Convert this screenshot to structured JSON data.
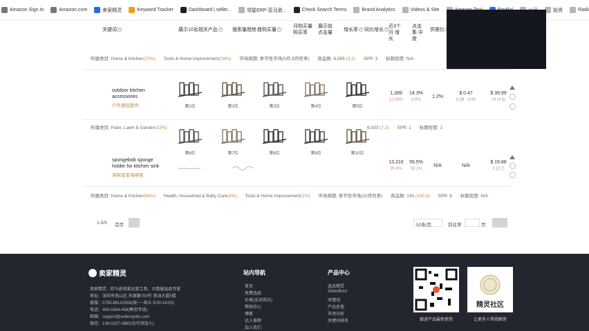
{
  "bookmarks": [
    {
      "label": "Amazon Sign In",
      "icon": "amazon-icon",
      "color": "gray"
    },
    {
      "label": "Amazon.com",
      "icon": "amazon-icon",
      "color": "gray"
    },
    {
      "label": "卖家精灵",
      "icon": "seller-sprite-icon",
      "color": "blue"
    },
    {
      "label": "Keyword Tracker",
      "icon": "tracker-icon",
      "color": "orange"
    },
    {
      "label": "Dashboard | seller...",
      "icon": "dashboard-icon",
      "color": "dark"
    },
    {
      "label": "领星ERP-亚马逊...",
      "icon": "folder-icon",
      "color": "folder"
    },
    {
      "label": "Check Search Terms",
      "icon": "check-icon",
      "color": "dark"
    },
    {
      "label": "Brand Analytics",
      "icon": "folder-icon",
      "color": "folder"
    },
    {
      "label": "Videos & Site",
      "icon": "folder-icon",
      "color": "folder"
    },
    {
      "label": "Amazon Tool",
      "icon": "folder-icon",
      "color": "folder"
    },
    {
      "label": "PayPal",
      "icon": "paypal-icon",
      "color": "blue"
    },
    {
      "label": "公司",
      "icon": "folder-icon",
      "color": "folder"
    },
    {
      "label": "投资",
      "icon": "folder-icon",
      "color": "folder"
    },
    {
      "label": "Radio",
      "icon": "folder-icon",
      "color": "folder"
    }
  ],
  "table_header": {
    "col_keyword": "关键词",
    "col_top10": "展示10名相关产品",
    "col_search_volume": "搜索量趋势",
    "col_purchase": "月购买量",
    "col_top3_click": "月购买量 购买率",
    "col_click_share": "展示前 点击量",
    "col_growth": "增长率",
    "col_seasonal": "同比增长",
    "col_3m": "近3个月 增长",
    "col_concentration": "点击集 中度",
    "col_supply": "供需比"
  },
  "rows": [
    {
      "category_line": {
        "prefix": "所属类目:",
        "categories": [
          {
            "name": "Home & Kitchen",
            "pct": "(70%)"
          },
          {
            "name": "Tools & Home Improvement",
            "pct": "(29%)"
          }
        ],
        "market_cycle_label": "市场周期:",
        "market_cycle_value": "季节性市场(5月,8月旺季)",
        "products_label": "商品数:",
        "products_value": "6,565",
        "products_ratio": "(2.2)",
        "spr_label": "SPR:",
        "spr_value": "3",
        "title_density_label": "标题密度:",
        "title_density_value": "N/A"
      }
    },
    {
      "keyword": "outdoor kitchen accessories",
      "translation": "户外厨房配件",
      "thumbs": [
        "第1位",
        "第2位",
        "第3位",
        "第4位",
        "第5位"
      ],
      "purchase": "1,389",
      "purchase_rate": "12.04%",
      "click_share": "14.3%",
      "click_share_sub": "6.8%",
      "concentration": "1.2%",
      "ppc": "$ 0.47",
      "ppc_range": "0.38 - 0.90",
      "price": "$ 39.99",
      "price_rating": "79 (4.5)"
    },
    {
      "category_line": {
        "prefix": "所属类目:",
        "categories": [
          {
            "name": "Patio, Lawn & Garden",
            "pct": "(33%)"
          }
        ],
        "products_value": "6,033",
        "products_ratio": "(7.2)",
        "spr_label": "SPR:",
        "spr_value": "1",
        "title_density_label": "标题密度:",
        "title_density_value": "1"
      }
    },
    {
      "keyword": "spongebob sponge holder for kitchen sink",
      "translation": "海绵宝宝海绵架",
      "thumbs": [
        "第6位",
        "第7位",
        "第8位",
        "第9位",
        "第10位"
      ],
      "purchase": "13,316",
      "purchase_rate": "95.6%",
      "click_share": "56.5%",
      "click_share_sub": "56.1%",
      "concentration": "N/A",
      "ppc": "N/A",
      "price": "$ 19.88",
      "price_rating": "2 (2.7)"
    },
    {
      "category_line": {
        "prefix": "所属类目:",
        "categories": [
          {
            "name": "Home & Kitchen",
            "pct": "(94%)"
          },
          {
            "name": "Health, Household & Baby Care",
            "pct": "(4%)"
          },
          {
            "name": "Tools & Home Improvement",
            "pct": "(2%)"
          }
        ],
        "market_cycle_label": "市场周期:",
        "market_cycle_value": "季节性市场(10月旺季)",
        "products_label": "商品数:",
        "products_value": "135",
        "products_ratio": "(100.0)",
        "spr_label": "SPR:",
        "spr_value": "6",
        "title_density_label": "标题密度:",
        "title_density_value": "N/A"
      }
    }
  ],
  "pager": {
    "range": "1-5/5",
    "prev": "首页",
    "per_page": "50条/页",
    "goto": "前往第",
    "page_suffix": "页"
  },
  "footer": {
    "brand": "卖家精灵",
    "info_lines": [
      "卖家精灵 - 亚马逊卖家运营工具，大数据选品专家",
      "地址：深圳市南山区 天源路700号 南油大厦5楼",
      "客服：0755-86142568(周一~周五 9:00-18:00)",
      "电话：400-0344-458(售前专线)",
      "邮箱：support@sellersprite.com",
      "微信：139-0327-0865(仅可添加人)"
    ],
    "nav_title": "站内导航",
    "nav_links": [
      "首页",
      "免费选品",
      "价格(会员购买)",
      "帮助中心",
      "博客",
      "达人推荐",
      "加入我们"
    ],
    "product_title": "产品中心",
    "product_links": [
      "选品精灵",
      "SellerBord",
      "关键词",
      "产品反查",
      "市场分析",
      "关键词排名"
    ],
    "qr1_caption": "跟进产品最新使用",
    "qr2_title": "精灵社区",
    "qr2_caption": "让更多人帮我解答"
  }
}
